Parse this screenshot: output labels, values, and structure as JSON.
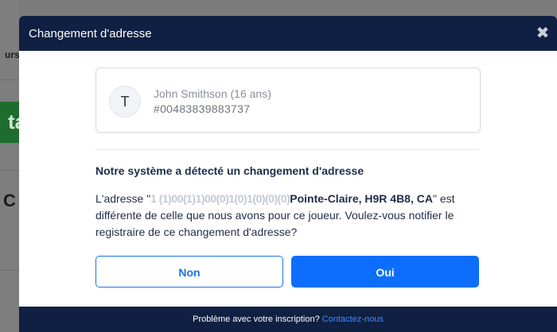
{
  "background": {
    "fragment_left": "urs",
    "fragment_green": "ta",
    "fragment_bold": "C"
  },
  "modal": {
    "title": "Changement d'adresse",
    "close_icon": "close-icon",
    "player": {
      "avatar_initial": "T",
      "name": "John Smithson (16 ans)",
      "id": "#00483839883737"
    },
    "heading": "Notre système a détecté un changement d'adresse",
    "message": {
      "prefix": "L'adresse \"",
      "obscured": "1 (1)00(1)1)00(0)1(0)1(0)(0)(0)",
      "address_visible": "Pointe-Claire, H9R 4B8, CA",
      "suffix": "\" est différente de celle que nous avons pour ce joueur. Voulez-vous notifier le registraire de ce changement d'adresse?"
    },
    "buttons": {
      "no_label": "Non",
      "yes_label": "Oui"
    },
    "footer": {
      "text": "Problème avec votre inscription? ",
      "link": "Contactez-nous"
    }
  },
  "colors": {
    "header_bg": "#0f2042",
    "primary": "#0d6efd",
    "text": "#1f2c4a"
  }
}
